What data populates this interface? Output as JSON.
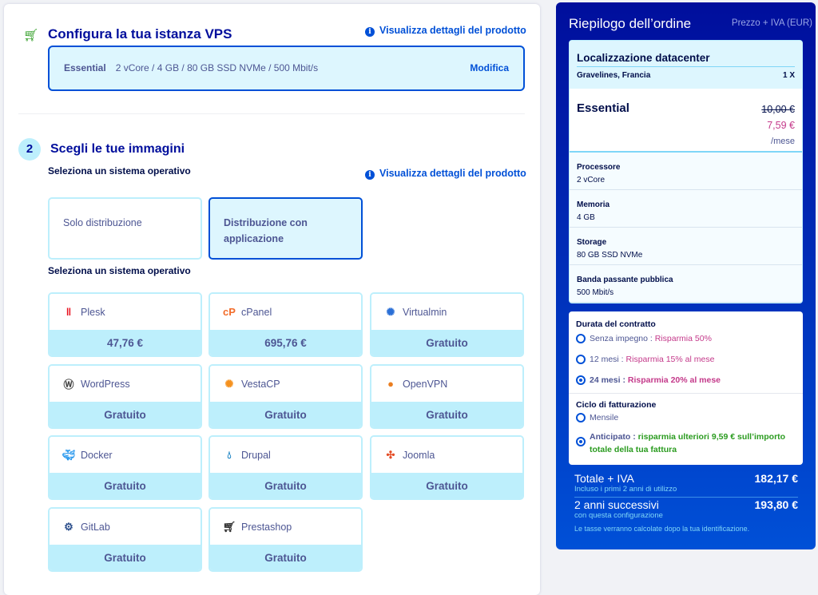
{
  "config": {
    "title": "Configura la tua istanza VPS",
    "details_link": "Visualizza dettagli del prodotto",
    "plan": "Essential",
    "specs": "2 vCore  / 4 GB  / 80 GB SSD NVMe  / 500 Mbit/s",
    "edit": "Modifica"
  },
  "step2": {
    "number": "2",
    "title": "Scegli le tue immagini",
    "label1": "Seleziona un sistema operativo",
    "details_link": "Visualizza dettagli del prodotto",
    "label2": "Seleziona un sistema operativo",
    "types": [
      {
        "label": "Solo distribuzione"
      },
      {
        "label": "Distribuzione con applicazione"
      }
    ],
    "images": [
      {
        "name": "Plesk",
        "price": "47,76 €"
      },
      {
        "name": "cPanel",
        "price": "695,76 €"
      },
      {
        "name": "Virtualmin",
        "price": "Gratuito"
      },
      {
        "name": "WordPress",
        "price": "Gratuito"
      },
      {
        "name": "VestaCP",
        "price": "Gratuito"
      },
      {
        "name": "OpenVPN",
        "price": "Gratuito"
      },
      {
        "name": "Docker",
        "price": "Gratuito"
      },
      {
        "name": "Drupal",
        "price": "Gratuito"
      },
      {
        "name": "Joomla",
        "price": "Gratuito"
      },
      {
        "name": "GitLab",
        "price": "Gratuito"
      },
      {
        "name": "Prestashop",
        "price": "Gratuito"
      }
    ]
  },
  "order": {
    "title": "Riepilogo dell’ordine",
    "price_note": "Prezzo + IVA (EUR)",
    "location_title": "Localizzazione datacenter",
    "location": "Gravelines, Francia",
    "qty": "1 X",
    "plan": "Essential",
    "old_price": "10,00 €",
    "new_price": "7,59 €",
    "per": "/mese",
    "specs": [
      {
        "k": "Processore",
        "v": "2 vCore"
      },
      {
        "k": "Memoria",
        "v": "4 GB"
      },
      {
        "k": "Storage",
        "v": "80 GB SSD NVMe"
      },
      {
        "k": "Banda passante pubblica",
        "v": "500 Mbit/s"
      }
    ],
    "duration_title": "Durata del contratto",
    "durations": [
      {
        "a": "Senza impegno : ",
        "b": "Risparmia 50%"
      },
      {
        "a": "12 mesi : ",
        "b": "Risparmia 15% al mese"
      },
      {
        "a": "24 mesi : ",
        "b": "Risparmia 20% al mese"
      }
    ],
    "billing_title": "Ciclo di fatturazione",
    "billing_monthly": "Mensile",
    "billing_advance_a": "Anticipato : ",
    "billing_advance_b": "risparmia ulteriori 9,59 € sull’importo totale della tua fattura",
    "total_label": "Totale + IVA",
    "total_sub": "Incluso i primi 2 anni di utilizzo",
    "total": "182,17 €",
    "next_label": "2 anni successivi",
    "next_sub": "con questa configurazione",
    "next": "193,80 €",
    "tax_note": "Le tasse verranno calcolate dopo la tua identificazione."
  }
}
